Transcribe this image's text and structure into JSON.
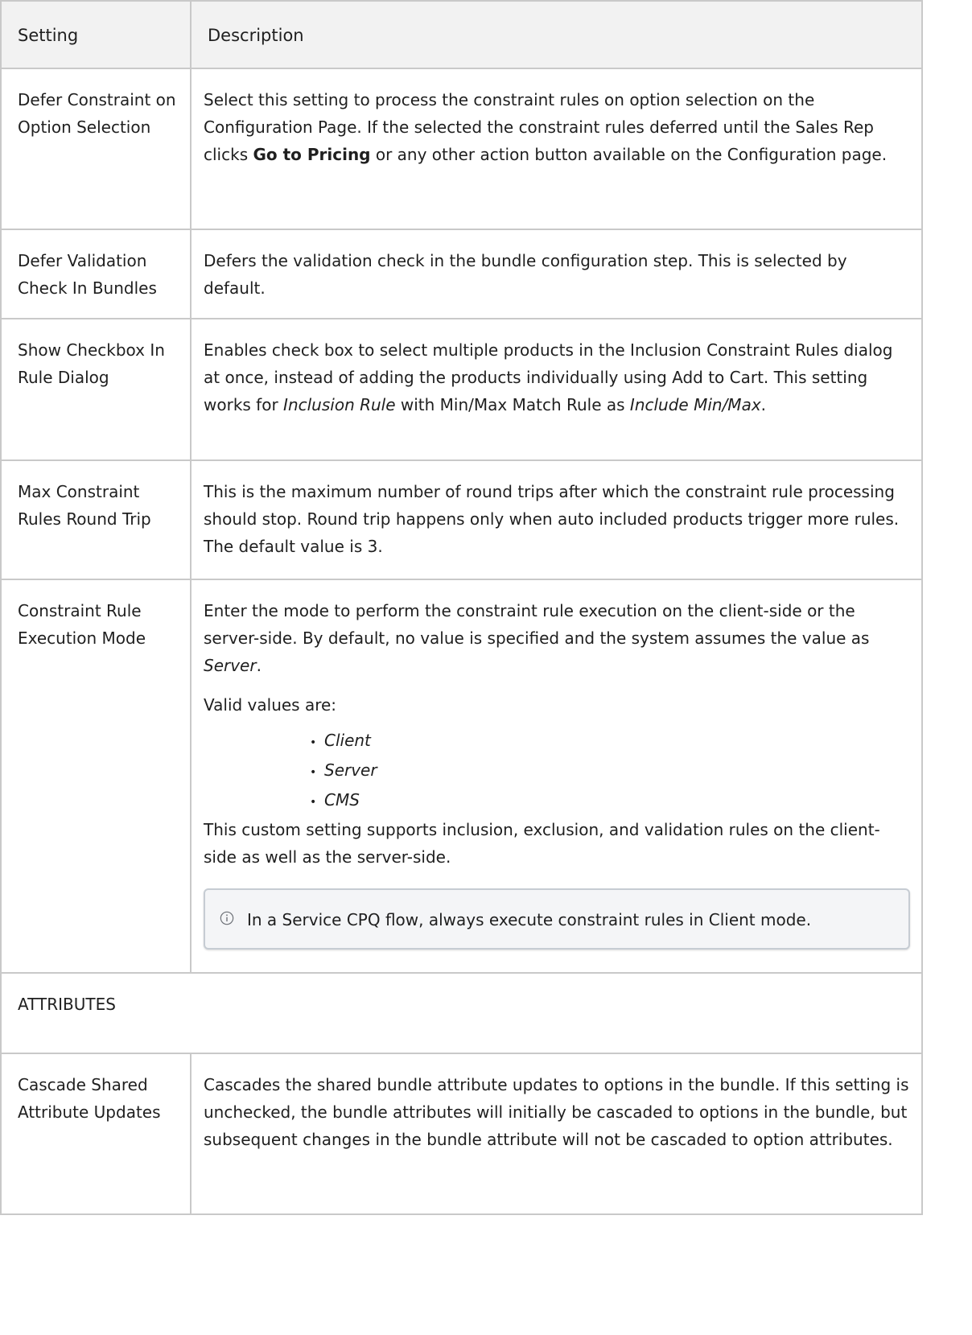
{
  "table": {
    "headers": [
      "Setting",
      "Description"
    ],
    "rows": [
      {
        "name": "Defer Constraint on Option Selection",
        "desc": {
          "pre": "Select this setting to process the constraint rules on option selection on the Configuration Page. If the selected the constraint rules deferred until the Sales Rep clicks ",
          "bold": "Go to Pricing",
          "post": " or any other action button available on the Configuration page."
        }
      },
      {
        "name": "Defer Validation Check In Bundles",
        "desc": "Defers the validation check in the bundle configuration step. This is selected by default."
      },
      {
        "name": "Show Checkbox In Rule Dialog",
        "desc": {
          "pre": "Enables check box to select multiple products in the Inclusion Constraint Rules dialog at once, instead of adding the products individually using Add to Cart. This setting works for ",
          "italic1": "Inclusion Rule",
          "mid": " with Min/Max Match Rule as ",
          "italic2": "Include Min/Max",
          "post": "."
        }
      },
      {
        "name": "Max Constraint Rules Round Trip",
        "desc": "This is the maximum number of round trips after which the constraint rule processing should stop. Round trip happens only when auto included products trigger more rules. The default value is 3."
      },
      {
        "name": "Constraint Rule Execution Mode",
        "desc": {
          "pre": "Enter the mode to perform the constraint rule execution on the client-side or the server-side. By default, no value is specified and the system assumes the value as ",
          "italic": "Server",
          "post": ".",
          "valid_label": "Valid values are:",
          "values": [
            "Client",
            "Server",
            "CMS"
          ],
          "after": "This custom setting supports inclusion, exclusion, and validation rules on the client-side as well as the server-side.",
          "note": "In a Service CPQ flow, always execute constraint rules in Client mode.",
          "note_icon": "info-icon"
        }
      }
    ],
    "section_label": "ATTRIBUTES",
    "attr_row": {
      "name": "Cascade Shared Attribute Updates",
      "desc": "Cascades the shared bundle attribute updates to options in the bundle. If this setting is unchecked, the bundle attributes will initially be cascaded to options in the bundle, but subsequent changes in the bundle attribute will not be cascaded to option attributes."
    }
  },
  "colors": {
    "border": "#c9c9c9",
    "header_bg": "#f2f2f2",
    "note_bg": "#f4f5f7",
    "note_border": "#c6ccd3"
  }
}
